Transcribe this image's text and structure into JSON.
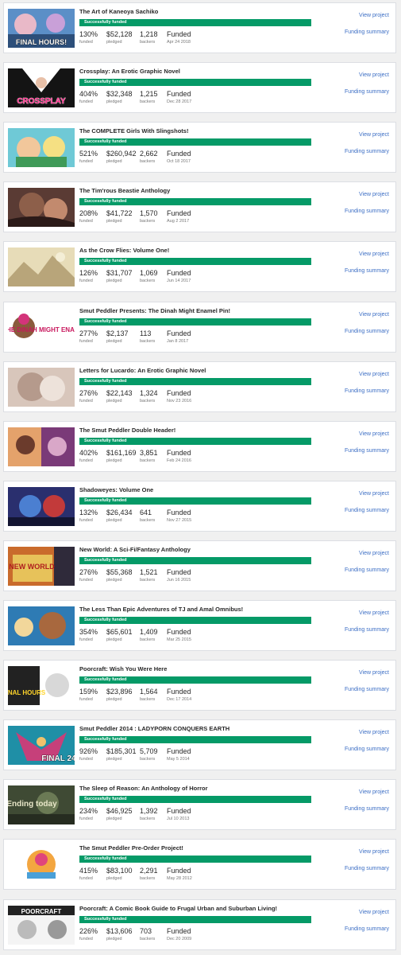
{
  "labels": {
    "status": "Successfully funded",
    "funded": "funded",
    "pledged": "pledged",
    "backers": "backers",
    "view_project": "View project",
    "funding_summary": "Funding summary"
  },
  "colors": {
    "funded_bar": "#059a67",
    "link": "#3d6fc5"
  },
  "projects": [
    {
      "title": "The Art of Kaneoya Sachiko",
      "percent": "130%",
      "pledged": "$52,128",
      "backers": "1,218",
      "status": "Funded",
      "date": "Apr 24 2018",
      "progress": 1.0,
      "thumb": "final-hours-cover",
      "thumb_text": "FINAL HOURS!"
    },
    {
      "title": "Crossplay: An Erotic Graphic Novel",
      "percent": "404%",
      "pledged": "$32,348",
      "backers": "1,215",
      "status": "Funded",
      "date": "Dec 28 2017",
      "progress": 1.0,
      "thumb": "crossplay-cover",
      "thumb_text": "CROSSPLAY"
    },
    {
      "title": "The COMPLETE Girls With Slingshots!",
      "percent": "521%",
      "pledged": "$260,942",
      "backers": "2,662",
      "status": "Funded",
      "date": "Oct 18 2017",
      "progress": 1.0,
      "thumb": "slingshots-cover",
      "thumb_text": ""
    },
    {
      "title": "The Tim'rous Beastie Anthology",
      "percent": "208%",
      "pledged": "$41,722",
      "backers": "1,570",
      "status": "Funded",
      "date": "Aug 2 2017",
      "progress": 1.0,
      "thumb": "beastie-cover",
      "thumb_text": ""
    },
    {
      "title": "As the Crow Flies: Volume One!",
      "percent": "126%",
      "pledged": "$31,707",
      "backers": "1,069",
      "status": "Funded",
      "date": "Jun 14 2017",
      "progress": 1.0,
      "thumb": "crow-flies-cover",
      "thumb_text": ""
    },
    {
      "title": "Smut Peddler Presents: The Dinah Might Enamel Pin!",
      "percent": "277%",
      "pledged": "$2,137",
      "backers": "113",
      "status": "Funded",
      "date": "Jan 8 2017",
      "progress": 1.0,
      "thumb": "dinah-might-cover",
      "thumb_text": "THE DINAH MIGHT ENAMEL PIN!"
    },
    {
      "title": "Letters for Lucardo: An Erotic Graphic Novel",
      "percent": "276%",
      "pledged": "$22,143",
      "backers": "1,324",
      "status": "Funded",
      "date": "Nov 23 2016",
      "progress": 1.0,
      "thumb": "lucardo-cover",
      "thumb_text": ""
    },
    {
      "title": "The Smut Peddler Double Header!",
      "percent": "402%",
      "pledged": "$161,169",
      "backers": "3,851",
      "status": "Funded",
      "date": "Feb 24 2016",
      "progress": 1.0,
      "thumb": "double-header-cover",
      "thumb_text": ""
    },
    {
      "title": "Shadoweyes: Volume One",
      "percent": "132%",
      "pledged": "$26,434",
      "backers": "641",
      "status": "Funded",
      "date": "Nov 27 2015",
      "progress": 1.0,
      "thumb": "shadoweyes-cover",
      "thumb_text": ""
    },
    {
      "title": "New World: A Sci-Fi/Fantasy Anthology",
      "percent": "276%",
      "pledged": "$55,368",
      "backers": "1,521",
      "status": "Funded",
      "date": "Jun 16 2015",
      "progress": 1.0,
      "thumb": "new-world-cover",
      "thumb_text": "NEW WORLD"
    },
    {
      "title": "The Less Than Epic Adventures of TJ and Amal Omnibus!",
      "percent": "354%",
      "pledged": "$65,601",
      "backers": "1,409",
      "status": "Funded",
      "date": "Mar 25 2015",
      "progress": 1.0,
      "thumb": "tj-amal-cover",
      "thumb_text": ""
    },
    {
      "title": "Poorcraft: Wish You Were Here",
      "percent": "159%",
      "pledged": "$23,896",
      "backers": "1,564",
      "status": "Funded",
      "date": "Dec 17 2014",
      "progress": 1.0,
      "thumb": "poorcraft-wish-cover",
      "thumb_text": "FINAL HOURS"
    },
    {
      "title": "Smut Peddler 2014 : LADYPORN CONQUERS EARTH",
      "percent": "926%",
      "pledged": "$185,301",
      "backers": "5,709",
      "status": "Funded",
      "date": "May 5 2014",
      "progress": 1.0,
      "thumb": "smut-peddler-2014-cover",
      "thumb_text": "FINAL 24"
    },
    {
      "title": "The Sleep of Reason: An Anthology of Horror",
      "percent": "234%",
      "pledged": "$46,925",
      "backers": "1,392",
      "status": "Funded",
      "date": "Jul 10 2013",
      "progress": 1.0,
      "thumb": "sleep-of-reason-cover",
      "thumb_text": "Ending today"
    },
    {
      "title": "The Smut Peddler Pre-Order Project!",
      "percent": "415%",
      "pledged": "$83,100",
      "backers": "2,291",
      "status": "Funded",
      "date": "May 28 2012",
      "progress": 1.0,
      "thumb": "pre-order-cover",
      "thumb_text": ""
    },
    {
      "title": "Poorcraft: A Comic Book Guide to Frugal Urban and Suburban Living!",
      "percent": "226%",
      "pledged": "$13,606",
      "backers": "703",
      "status": "Funded",
      "date": "Dec 20 2009",
      "progress": 1.0,
      "thumb": "poorcraft-guide-cover",
      "thumb_text": "POORCRAFT"
    }
  ]
}
